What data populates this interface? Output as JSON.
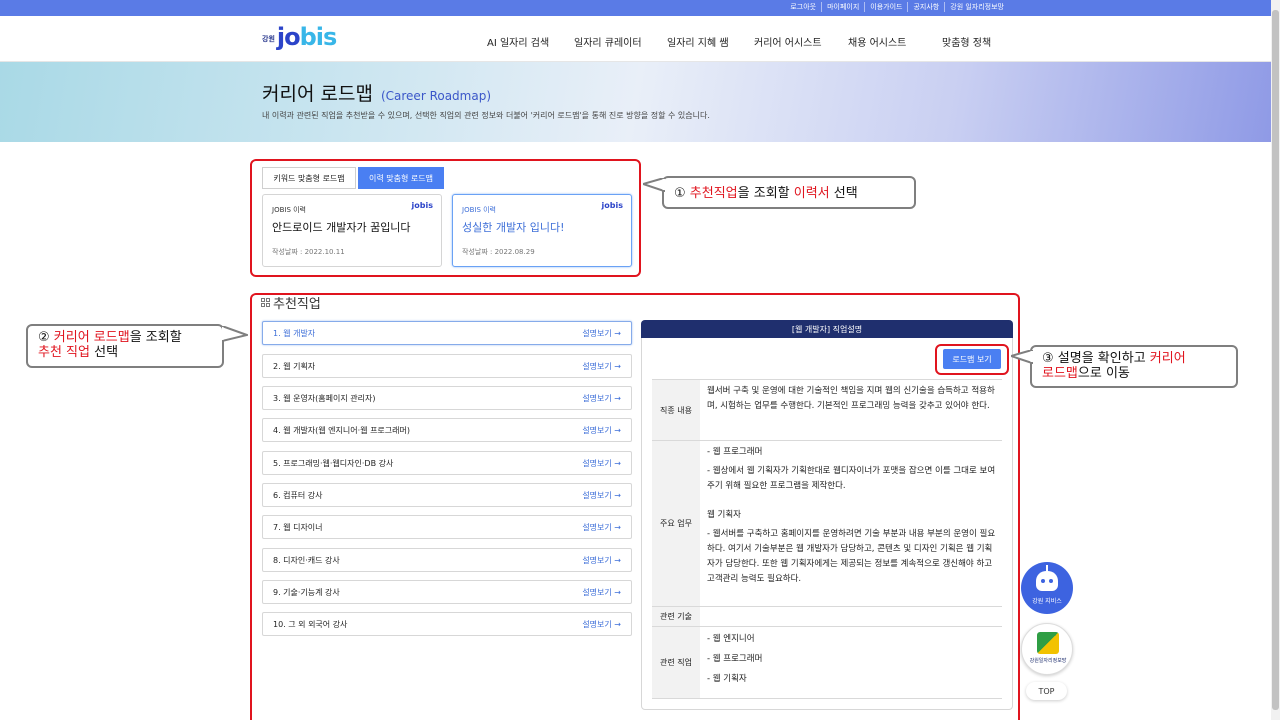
{
  "util_links": [
    "로그아웃",
    "마이페이지",
    "이용가이드",
    "공지사항",
    "강원 일자리정보망"
  ],
  "logo": {
    "small": "강원",
    "text": "jo",
    "text2": "bis"
  },
  "gnb": [
    "AI 일자리 검색",
    "일자리 큐레이터",
    "일자리 지혜 쌤",
    "커리어 어시스트",
    "채용 어시스트",
    "맞춤형 정책"
  ],
  "hero": {
    "title": "커리어 로드맵",
    "subtitle": "(Career Roadmap)",
    "desc": "내 이력과 관련된 직업을 추천받을 수 있으며, 선택한 직업의 관련 정보와 더불어 '커리어 로드맵'을 통해 진로 방향을 정할 수 있습니다."
  },
  "tabs": [
    "키워드 맞춤형 로드맵",
    "이력 맞춤형 로드맵"
  ],
  "resumes": [
    {
      "label": "JOBIS 이력",
      "mini": "jobis",
      "title": "안드로이드 개발자가 꿈입니다",
      "date": "작성날짜 : 2022.10.11"
    },
    {
      "label": "JOBIS 이력",
      "mini": "jobis",
      "title": "성실한 개발자 입니다!",
      "date": "작성날짜 : 2022.08.29"
    }
  ],
  "callouts": {
    "c1": {
      "num": "①",
      "a": "추천직업",
      "b": "을 조회할 ",
      "c": "이력서",
      "d": " 선택"
    },
    "c2": {
      "num": "②",
      "a": "커리어 로드맵",
      "b": "을 조회할",
      "c": "추천 직업",
      "d": " 선택"
    },
    "c3": {
      "num": "③",
      "a": "설명을 확인하고 ",
      "b": "커리어",
      "c": "로드맵",
      "d": "으로 이동"
    }
  },
  "rec_title": "추천직업",
  "jobs": [
    "1. 웹 개발자",
    "2. 웹 기획자",
    "3. 웹 운영자(홈페이지 관리자)",
    "4. 웹 개발자(웹 엔지니어·웹 프로그래머)",
    "5. 프로그래밍·웹·웹디자인·DB 강사",
    "6. 컴퓨터 강사",
    "7. 웹 디자이너",
    "8. 디자인·캐드 강사",
    "9. 기술·기능계 강사",
    "10. 그 외 외국어 강사"
  ],
  "more_label": "설명보기 →",
  "panel": {
    "head": "[웹 개발자] 직업설명",
    "roadmap_btn": "로드맵 보기",
    "rows": [
      {
        "th": "직종 내용",
        "td": "웹서버 구축 및 운영에 대한 기술적인 책임을 지며 웹의 신기술을 습득하고 적용하며, 시험하는 업무를 수행한다. 기본적인 프로그래밍 능력을 갖추고 있어야 한다."
      },
      {
        "th": "주요 업무",
        "td1": "- 웹 프로그래머",
        "td2": "- 웹상에서 웹 기획자가 기획한대로 웹디자이너가 포맷을 잡으면 이를 그대로 보여주기 위해 필요한 프로그램을 제작한다.",
        "td3": "웹 기획자",
        "td4": "- 웹서버를 구축하고 홈페이지를 운영하려면 기술 부분과 내용 부분의 운영이 필요하다. 여기서 기술부분은 웹 개발자가 담당하고, 콘텐츠 및 디자인 기획은 웹 기획자가 담당한다. 또한 웹 기획자에게는 제공되는 정보를 계속적으로 갱신해야 하고 고객관리 능력도 필요하다."
      },
      {
        "th": "관련 기술",
        "td": ""
      },
      {
        "th": "관련 직업",
        "td1": "- 웹 엔지니어",
        "td2": "- 웹 프로그래머",
        "td3": "- 웹 기획자"
      }
    ]
  },
  "fab": {
    "ai": "강원 지비스",
    "gw": "강원일자리정보망",
    "top": "TOP"
  },
  "colors": {
    "accent": "#4a7ff2",
    "highlight": "#e0141e",
    "panel_head": "#1f2f6e"
  }
}
